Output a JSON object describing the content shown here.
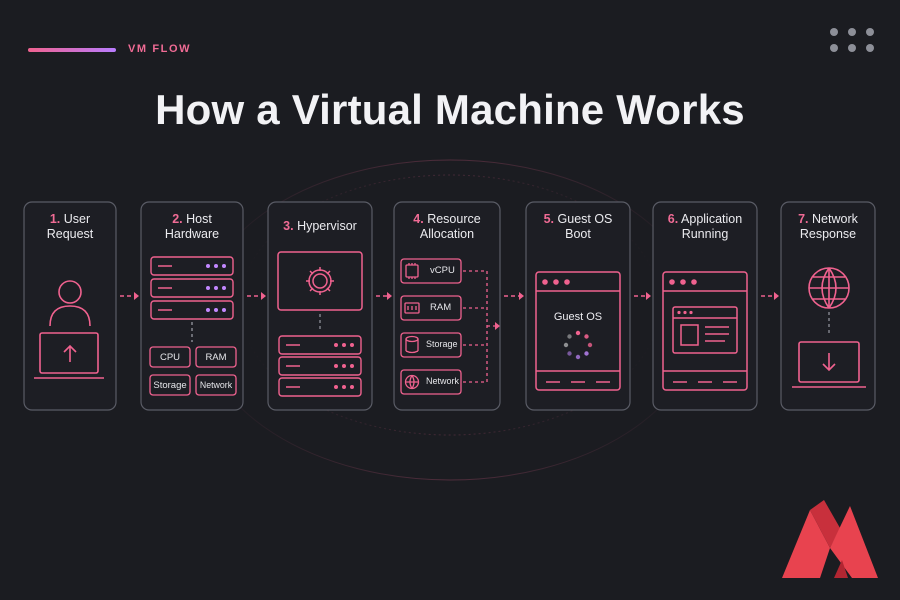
{
  "header": {
    "eyebrow": "VM FLOW",
    "title": "How a Virtual Machine Works"
  },
  "colors": {
    "accent": "#f0628f",
    "accent_purple": "#b87cff",
    "background": "#1b1c21",
    "card_border": "#5a5c66"
  },
  "steps": [
    {
      "num": "1.",
      "line1": "User",
      "line2": "Request",
      "icon": "user-laptop-upload-icon"
    },
    {
      "num": "2.",
      "line1": "Host",
      "line2": "Hardware",
      "icon": "server-rack-icon"
    },
    {
      "num": "3.",
      "line1": "Hypervisor",
      "line2": "",
      "icon": "gear-window-icon"
    },
    {
      "num": "4.",
      "line1": "Resource",
      "line2": "Allocation",
      "icon": "resource-list-icon"
    },
    {
      "num": "5.",
      "line1": "Guest OS",
      "line2": "Boot",
      "icon": "os-window-icon"
    },
    {
      "num": "6.",
      "line1": "Application",
      "line2": "Running",
      "icon": "app-window-icon"
    },
    {
      "num": "7.",
      "line1": "Network",
      "line2": "Response",
      "icon": "globe-laptop-download-icon"
    }
  ],
  "host_chips": [
    "CPU",
    "RAM",
    "Storage",
    "Network"
  ],
  "resources": [
    "vCPU",
    "RAM",
    "Storage",
    "Network"
  ],
  "guest_os_label": "Guest OS"
}
